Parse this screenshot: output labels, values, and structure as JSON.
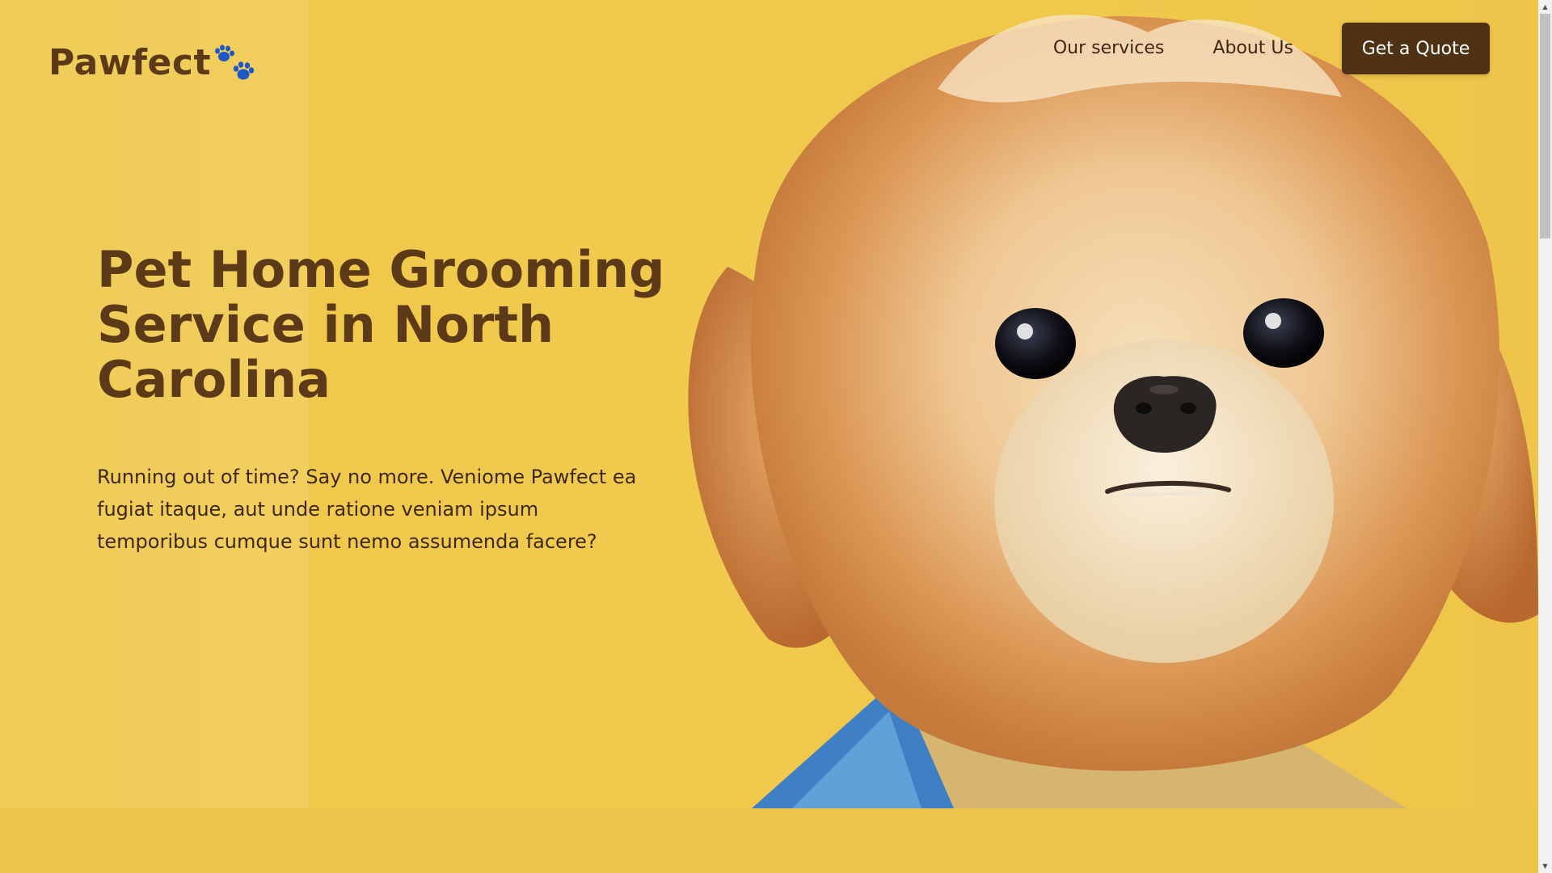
{
  "brand": {
    "name": "Pawfect",
    "logo_icon": "paw-prints-icon",
    "logo_icon_color": "#1f57c7",
    "text_color": "#5c3a17"
  },
  "nav": {
    "links": [
      {
        "label": "Our services"
      },
      {
        "label": "About Us"
      }
    ],
    "cta_label": "Get a Quote",
    "cta_color": "#4f3214"
  },
  "hero": {
    "headline": "Pet Home Grooming Service in North Carolina",
    "description": "Running out of time? Say no more. Veniome Pawfect ea fugiat itaque, aut unde ratione veniam ipsum temporibus cumque sunt nemo assumenda facere?",
    "background_color": "#f1ca4d",
    "image": "small fluffy tan dog with bandana"
  },
  "scrollbar": {
    "up_icon": "scroll-up-arrow-icon",
    "down_icon": "scroll-down-arrow-icon"
  }
}
